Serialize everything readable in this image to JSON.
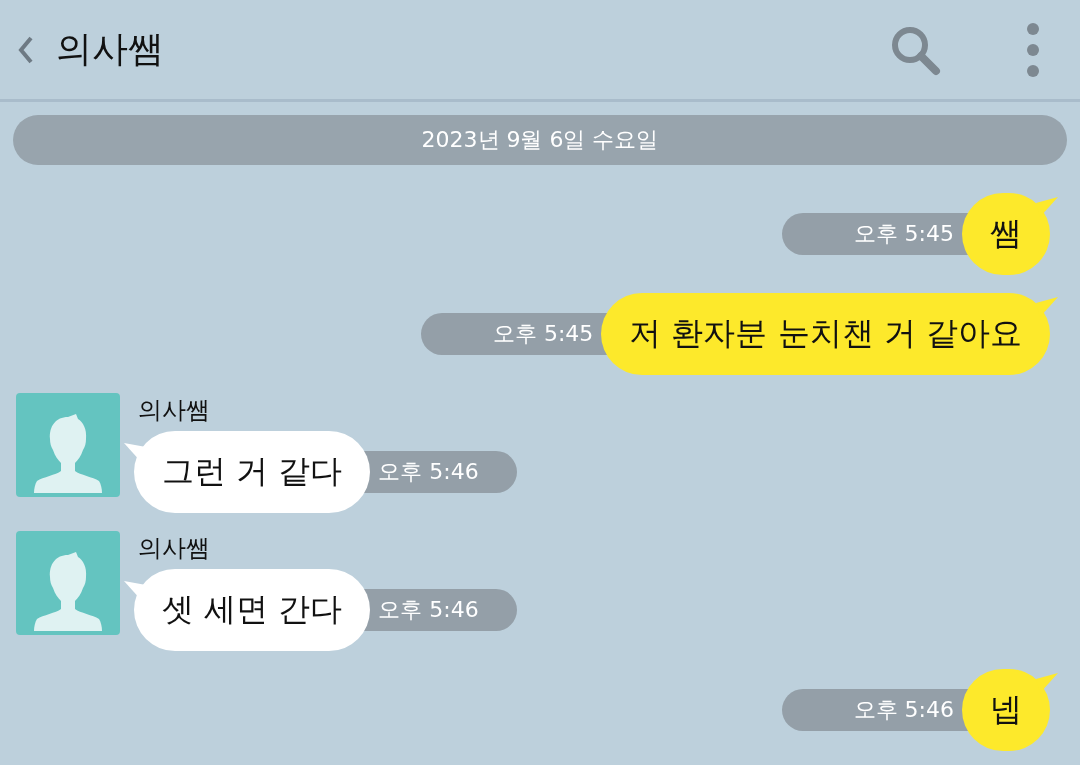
{
  "header": {
    "title": "의사쌤"
  },
  "date_divider": "2023년 9월 6일 수요일",
  "messages": [
    {
      "kind": "sent",
      "text": "쌤",
      "time": "오후 5:45"
    },
    {
      "kind": "sent",
      "text": "저 환자분 눈치챈 거 같아요",
      "time": "오후 5:45"
    },
    {
      "kind": "received",
      "sender": "의사쌤",
      "text": "그런 거 같다",
      "time": "오후 5:46"
    },
    {
      "kind": "received",
      "sender": "의사쌤",
      "text": "셋 세면 간다",
      "time": "오후 5:46"
    },
    {
      "kind": "sent",
      "text": "넵",
      "time": "오후 5:46"
    }
  ]
}
